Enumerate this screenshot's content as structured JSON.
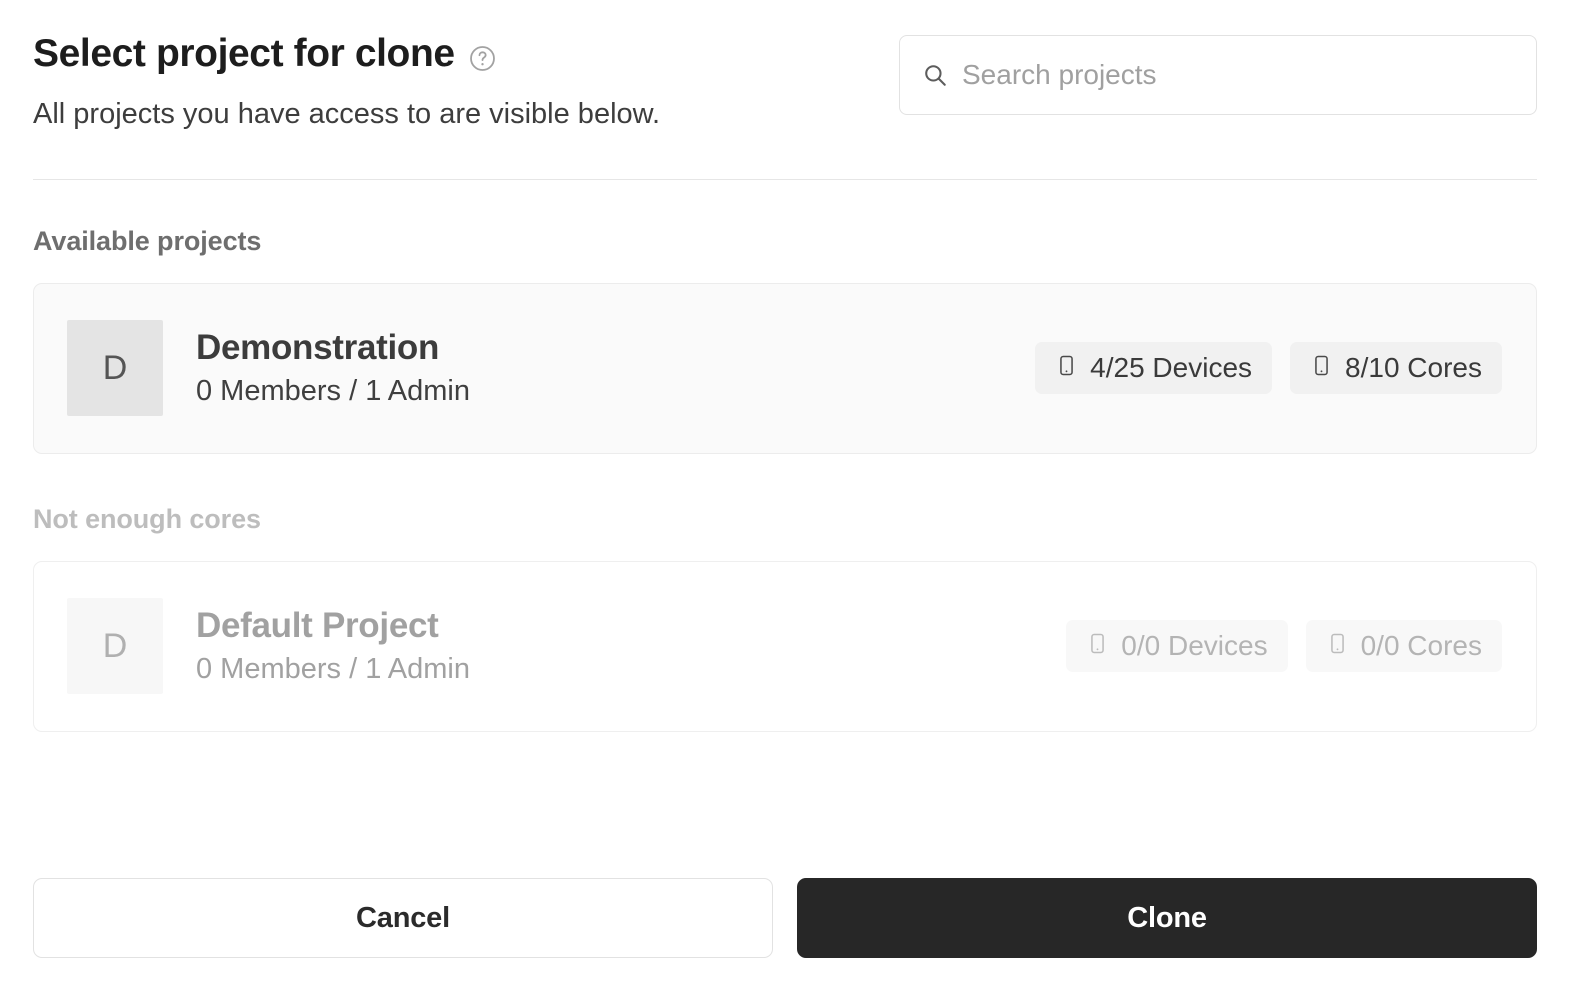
{
  "dialog": {
    "title": "Select project for clone",
    "help_icon": "help-circle-icon",
    "subtitle": "All projects you have access to are visible below."
  },
  "search": {
    "icon": "search-icon",
    "placeholder": "Search projects",
    "value": ""
  },
  "groups": [
    {
      "label": "Available projects",
      "disabled": false,
      "projects": [
        {
          "avatar_letter": "D",
          "name": "Demonstration",
          "members": "0 Members / 1 Admin",
          "badges": [
            {
              "icon": "device-icon",
              "text": "4/25 Devices"
            },
            {
              "icon": "device-icon",
              "text": "8/10 Cores"
            }
          ]
        }
      ]
    },
    {
      "label": "Not enough cores",
      "disabled": true,
      "projects": [
        {
          "avatar_letter": "D",
          "name": "Default Project",
          "members": "0 Members / 1 Admin",
          "badges": [
            {
              "icon": "device-icon",
              "text": "0/0 Devices"
            },
            {
              "icon": "device-icon",
              "text": "0/0 Cores"
            }
          ]
        }
      ]
    }
  ],
  "footer": {
    "cancel_label": "Cancel",
    "clone_label": "Clone"
  },
  "colors": {
    "primary_button": "#272727",
    "row_background": "#fafafa",
    "badge_background": "#f1f1f1",
    "muted_text": "#bdbdbd"
  }
}
